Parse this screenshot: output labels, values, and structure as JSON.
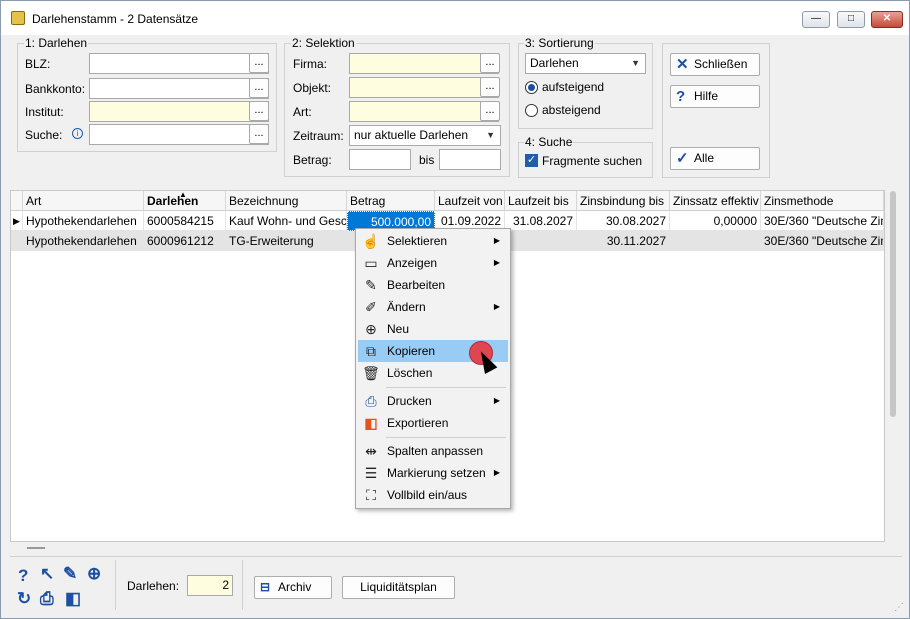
{
  "window": {
    "title": "Darlehenstamm - 2 Datensätze",
    "minimize": "—",
    "maximize": "□",
    "close": "✕"
  },
  "darlehen": {
    "group_label": "1: Darlehen",
    "blz_label": "BLZ:",
    "blz_value": "",
    "bankkonto_label": "Bankkonto:",
    "bankkonto_value": "",
    "institut_label": "Institut:",
    "institut_value": "",
    "suche_label": "Suche:",
    "suche_value": ""
  },
  "selektion": {
    "group_label": "2: Selektion",
    "firma_label": "Firma:",
    "objekt_label": "Objekt:",
    "art_label": "Art:",
    "zeitraum_label": "Zeitraum:",
    "zeitraum_value": "nur aktuelle Darlehen",
    "betrag_label": "Betrag:",
    "bis_label": "bis"
  },
  "sortierung": {
    "group_label": "3: Sortierung",
    "sort_value": "Darlehen",
    "asc_label": "aufsteigend",
    "desc_label": "absteigend",
    "selected": "aufsteigend"
  },
  "suche": {
    "group_label": "4: Suche",
    "fragment_label": "Fragmente suchen",
    "fragment_checked": true
  },
  "buttons": {
    "schliessen": "Schließen",
    "hilfe": "Hilfe",
    "alle": "Alle"
  },
  "table": {
    "columns": [
      "Art",
      "Darlehen",
      "Bezeichnung",
      "Betrag",
      "Laufzeit von",
      "Laufzeit bis",
      "Zinsbindung bis",
      "Zinssatz effektiv",
      "Zinsmethode"
    ],
    "rows": [
      [
        "Hypothekendarlehen",
        "6000584215",
        "Kauf Wohn- und Gesc",
        "500.000,00",
        "01.09.2022",
        "31.08.2027",
        "30.08.2027",
        "0,00000",
        "30E/360 \"Deutsche Zin"
      ],
      [
        "Hypothekendarlehen",
        "6000961212",
        "TG-Erweiterung",
        "",
        "",
        "",
        "30.11.2027",
        "",
        "30E/360 \"Deutsche Zin"
      ]
    ]
  },
  "context_menu": {
    "items": [
      {
        "label": "Selektieren",
        "icon": "hand-pointer-icon",
        "submenu": true
      },
      {
        "label": "Anzeigen",
        "icon": "monitor-icon",
        "submenu": true
      },
      {
        "label": "Bearbeiten",
        "icon": "pencil-icon",
        "submenu": false
      },
      {
        "label": "Ändern",
        "icon": "pencil-edit-icon",
        "submenu": true
      },
      {
        "label": "Neu",
        "icon": "plus-circle-icon",
        "submenu": false
      },
      {
        "label": "Kopieren",
        "icon": "copy-icon",
        "submenu": false
      },
      {
        "label": "Löschen",
        "icon": "trash-icon",
        "submenu": false
      },
      {
        "label": "Drucken",
        "icon": "printer-icon",
        "submenu": true
      },
      {
        "label": "Exportieren",
        "icon": "office-icon",
        "submenu": false
      },
      {
        "label": "Spalten anpassen",
        "icon": "column-resize-icon",
        "submenu": false
      },
      {
        "label": "Markierung setzen",
        "icon": "lines-icon",
        "submenu": true
      },
      {
        "label": "Vollbild ein/aus",
        "icon": "fullscreen-icon",
        "submenu": false
      }
    ],
    "highlighted": "Kopieren"
  },
  "footer": {
    "darlehen_label": "Darlehen:",
    "darlehen_count": "2",
    "archiv": "Archiv",
    "liquiditaetsplan": "Liquiditätsplan"
  },
  "colors": {
    "highlight": "#99ccf5",
    "selected_cell": "#0078d7",
    "yellow_input": "#fffde0",
    "accent": "#1f4fa0"
  }
}
